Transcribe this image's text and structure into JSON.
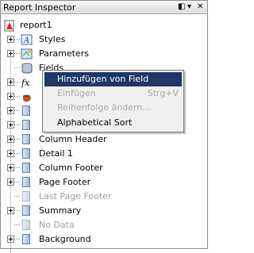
{
  "panel": {
    "title": "Report Inspector",
    "controls": [
      "◧",
      "▾",
      "✕"
    ]
  },
  "tree": {
    "root": "report1",
    "items": [
      {
        "label": "Styles",
        "icon": "styles-icon",
        "enabled": true,
        "expander": true
      },
      {
        "label": "Parameters",
        "icon": "parameters-icon",
        "enabled": true,
        "expander": true
      },
      {
        "label": "Fields",
        "icon": "fields-database-icon",
        "enabled": true,
        "expander": false
      },
      {
        "label": "",
        "icon": "variables-fx-icon",
        "enabled": true,
        "expander": true
      },
      {
        "label": "",
        "icon": "scriptlets-coffee-icon",
        "enabled": true,
        "expander": true
      },
      {
        "label": "",
        "icon": "band-icon",
        "enabled": true,
        "expander": true
      },
      {
        "label": "",
        "icon": "band-icon",
        "enabled": true,
        "expander": true
      },
      {
        "label": "Column Header",
        "icon": "band-icon",
        "enabled": true,
        "expander": true
      },
      {
        "label": "Detail 1",
        "icon": "band-icon",
        "enabled": true,
        "expander": true
      },
      {
        "label": "Column Footer",
        "icon": "band-icon",
        "enabled": true,
        "expander": true
      },
      {
        "label": "Page Footer",
        "icon": "band-icon",
        "enabled": true,
        "expander": true
      },
      {
        "label": "Last Page Footer",
        "icon": "band-icon",
        "enabled": false,
        "expander": false
      },
      {
        "label": "Summary",
        "icon": "band-icon",
        "enabled": true,
        "expander": true
      },
      {
        "label": "No Data",
        "icon": "band-icon",
        "enabled": false,
        "expander": false
      },
      {
        "label": "Background",
        "icon": "band-icon",
        "enabled": true,
        "expander": true
      }
    ]
  },
  "context_menu": {
    "items": [
      {
        "label": "Hinzufügen von Field",
        "shortcut": "",
        "enabled": true,
        "selected": true
      },
      {
        "label": "Einfügen",
        "shortcut": "Strg+V",
        "enabled": false,
        "selected": false
      },
      {
        "label": "Reihenfolge ändern...",
        "shortcut": "",
        "enabled": false,
        "selected": false
      },
      {
        "label": "Alphabetical Sort",
        "shortcut": "",
        "enabled": true,
        "selected": false
      }
    ]
  },
  "colors": {
    "selection": "#1f3768",
    "menu_bg": "#f0f0f0",
    "band": "#9fb8d8"
  }
}
